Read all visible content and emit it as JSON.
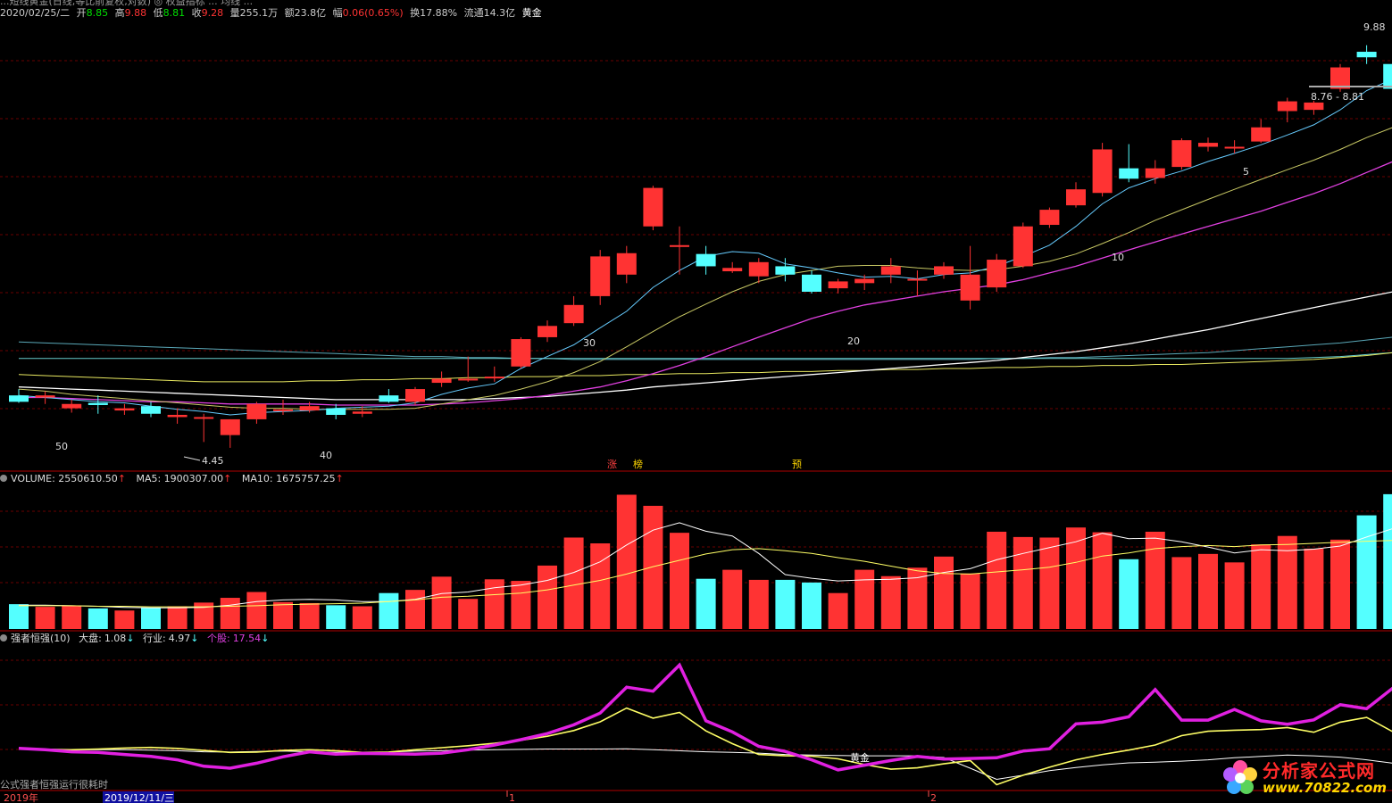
{
  "header": {
    "line1": "...短线黄金(日线,等比前复权,对数)  ◎ 权益指标 ...  均线 ...",
    "date": "2020/02/25/二",
    "open_label": "开",
    "open": "8.85",
    "high_label": "高",
    "high": "9.88",
    "low_label": "低",
    "low": "8.81",
    "close_label": "收",
    "close": "9.28",
    "vol_label": "量",
    "vol": "255.1万",
    "amt_label": "额",
    "amt": "23.8亿",
    "chg_label": "幅",
    "chg": "0.06(0.65%)",
    "turn_label": "换",
    "turn": "17.88%",
    "float_label": "流通",
    "float": "14.3亿",
    "tag": "黄金"
  },
  "price_panel": {
    "high_label": "9.88",
    "range_label": "8.76 - 8.81",
    "low_label": "4.45",
    "count_labels": [
      "50",
      "40",
      "30",
      "20",
      "10",
      "5"
    ],
    "event_labels": [
      "涨",
      "榜",
      "预"
    ]
  },
  "volume_panel": {
    "title": "VOLUME: 2550610.50",
    "ma5": "MA5: 1900307.00",
    "ma10": "MA10: 1675757.25"
  },
  "indicator_panel": {
    "name": "强者恒强(10)",
    "market_label": "大盘:",
    "market": "1.08",
    "industry_label": "行业:",
    "industry": "4.97",
    "stock_label": "个股:",
    "stock": "17.54",
    "cross_label": "黄金",
    "footer_note": "公式强者恒强运行很耗时"
  },
  "time_axis": {
    "year": "2019年",
    "cursor_date": "2019/12/11/三",
    "month_1": "1",
    "month_2": "2"
  },
  "logo": {
    "name": "分析家公式网",
    "url": "www.70822.com"
  },
  "colors": {
    "up": "#ff3333",
    "down": "#54ffff",
    "ma5": "#66ccff",
    "ma10": "#c8c864",
    "ma20": "#e040e0",
    "ma60": "#ffffff",
    "grid": "#6a0000"
  },
  "chart_data": [
    {
      "type": "candlestick",
      "title": "",
      "ylim": [
        4.3,
        10.0
      ],
      "y_scale": "log",
      "candles": [
        {
          "o": 4.92,
          "h": 4.98,
          "l": 4.85,
          "c": 4.86
        },
        {
          "o": 4.9,
          "h": 4.96,
          "l": 4.84,
          "c": 4.92
        },
        {
          "o": 4.8,
          "h": 4.88,
          "l": 4.76,
          "c": 4.84
        },
        {
          "o": 4.85,
          "h": 4.92,
          "l": 4.75,
          "c": 4.83
        },
        {
          "o": 4.78,
          "h": 4.84,
          "l": 4.74,
          "c": 4.8
        },
        {
          "o": 4.82,
          "h": 4.86,
          "l": 4.72,
          "c": 4.75
        },
        {
          "o": 4.72,
          "h": 4.8,
          "l": 4.66,
          "c": 4.74
        },
        {
          "o": 4.72,
          "h": 4.75,
          "l": 4.5,
          "c": 4.72
        },
        {
          "o": 4.56,
          "h": 4.7,
          "l": 4.45,
          "c": 4.7
        },
        {
          "o": 4.7,
          "h": 4.86,
          "l": 4.66,
          "c": 4.84
        },
        {
          "o": 4.78,
          "h": 4.88,
          "l": 4.74,
          "c": 4.79
        },
        {
          "o": 4.78,
          "h": 4.86,
          "l": 4.76,
          "c": 4.82
        },
        {
          "o": 4.8,
          "h": 4.84,
          "l": 4.7,
          "c": 4.74
        },
        {
          "o": 4.75,
          "h": 4.82,
          "l": 4.72,
          "c": 4.77
        },
        {
          "o": 4.92,
          "h": 4.98,
          "l": 4.85,
          "c": 4.86
        },
        {
          "o": 4.86,
          "h": 5.0,
          "l": 4.83,
          "c": 4.98
        },
        {
          "o": 5.04,
          "h": 5.15,
          "l": 5.0,
          "c": 5.08
        },
        {
          "o": 5.07,
          "h": 5.3,
          "l": 5.05,
          "c": 5.08
        },
        {
          "o": 5.1,
          "h": 5.2,
          "l": 5.05,
          "c": 5.1
        },
        {
          "o": 5.2,
          "h": 5.5,
          "l": 5.18,
          "c": 5.48
        },
        {
          "o": 5.5,
          "h": 5.68,
          "l": 5.45,
          "c": 5.62
        },
        {
          "o": 5.65,
          "h": 5.95,
          "l": 5.62,
          "c": 5.85
        },
        {
          "o": 5.95,
          "h": 6.5,
          "l": 5.85,
          "c": 6.42
        },
        {
          "o": 6.2,
          "h": 6.55,
          "l": 6.1,
          "c": 6.46
        },
        {
          "o": 6.8,
          "h": 7.35,
          "l": 6.75,
          "c": 7.32
        },
        {
          "o": 6.55,
          "h": 6.8,
          "l": 6.2,
          "c": 6.56
        },
        {
          "o": 6.45,
          "h": 6.55,
          "l": 6.2,
          "c": 6.3
        },
        {
          "o": 6.24,
          "h": 6.35,
          "l": 6.22,
          "c": 6.28
        },
        {
          "o": 6.18,
          "h": 6.4,
          "l": 6.1,
          "c": 6.35
        },
        {
          "o": 6.3,
          "h": 6.4,
          "l": 6.12,
          "c": 6.2
        },
        {
          "o": 6.2,
          "h": 6.25,
          "l": 5.98,
          "c": 6.0
        },
        {
          "o": 6.04,
          "h": 6.15,
          "l": 5.98,
          "c": 6.12
        },
        {
          "o": 6.1,
          "h": 6.2,
          "l": 6.02,
          "c": 6.15
        },
        {
          "o": 6.2,
          "h": 6.4,
          "l": 6.1,
          "c": 6.3
        },
        {
          "o": 6.14,
          "h": 6.25,
          "l": 5.95,
          "c": 6.15
        },
        {
          "o": 6.2,
          "h": 6.35,
          "l": 6.15,
          "c": 6.3
        },
        {
          "o": 5.9,
          "h": 6.55,
          "l": 5.8,
          "c": 6.2
        },
        {
          "o": 6.05,
          "h": 6.45,
          "l": 6.0,
          "c": 6.38
        },
        {
          "o": 6.3,
          "h": 6.85,
          "l": 6.28,
          "c": 6.8
        },
        {
          "o": 6.82,
          "h": 7.05,
          "l": 6.78,
          "c": 7.02
        },
        {
          "o": 7.08,
          "h": 7.4,
          "l": 7.05,
          "c": 7.3
        },
        {
          "o": 7.25,
          "h": 7.98,
          "l": 7.2,
          "c": 7.88
        },
        {
          "o": 7.6,
          "h": 7.96,
          "l": 7.4,
          "c": 7.45
        },
        {
          "o": 7.46,
          "h": 7.72,
          "l": 7.38,
          "c": 7.6
        },
        {
          "o": 7.62,
          "h": 8.05,
          "l": 7.58,
          "c": 8.02
        },
        {
          "o": 7.92,
          "h": 8.06,
          "l": 7.85,
          "c": 7.98
        },
        {
          "o": 7.92,
          "h": 8.02,
          "l": 7.82,
          "c": 7.92
        },
        {
          "o": 8.0,
          "h": 8.35,
          "l": 7.98,
          "c": 8.22
        },
        {
          "o": 8.48,
          "h": 8.7,
          "l": 8.3,
          "c": 8.64
        },
        {
          "o": 8.5,
          "h": 8.65,
          "l": 8.42,
          "c": 8.62
        },
        {
          "o": 8.85,
          "h": 9.28,
          "l": 8.8,
          "c": 9.22
        },
        {
          "o": 9.5,
          "h": 9.62,
          "l": 9.28,
          "c": 9.4
        },
        {
          "o": 9.28,
          "h": 9.88,
          "l": 8.81,
          "c": 8.85
        }
      ],
      "ma5": [
        4.92,
        4.9,
        4.88,
        4.86,
        4.85,
        4.82,
        4.79,
        4.77,
        4.74,
        4.76,
        4.77,
        4.78,
        4.8,
        4.81,
        4.82,
        4.85,
        4.93,
        4.99,
        5.03,
        5.18,
        5.3,
        5.42,
        5.6,
        5.78,
        6.05,
        6.25,
        6.42,
        6.48,
        6.46,
        6.33,
        6.28,
        6.22,
        6.17,
        6.18,
        6.15,
        6.2,
        6.22,
        6.3,
        6.42,
        6.56,
        6.8,
        7.1,
        7.32,
        7.45,
        7.56,
        7.7,
        7.82,
        7.95,
        8.1,
        8.26,
        8.5,
        8.82,
        9.02
      ],
      "ma10": [
        4.98,
        4.96,
        4.93,
        4.91,
        4.89,
        4.87,
        4.85,
        4.83,
        4.81,
        4.8,
        4.8,
        4.79,
        4.79,
        4.79,
        4.79,
        4.8,
        4.84,
        4.88,
        4.92,
        4.98,
        5.05,
        5.14,
        5.25,
        5.4,
        5.56,
        5.72,
        5.86,
        6.0,
        6.12,
        6.2,
        6.25,
        6.3,
        6.31,
        6.31,
        6.28,
        6.26,
        6.25,
        6.26,
        6.3,
        6.36,
        6.45,
        6.58,
        6.72,
        6.88,
        7.02,
        7.16,
        7.3,
        7.44,
        7.58,
        7.72,
        7.88,
        8.06,
        8.22
      ],
      "ma20": [
        4.9,
        4.9,
        4.89,
        4.88,
        4.87,
        4.86,
        4.86,
        4.85,
        4.84,
        4.84,
        4.84,
        4.84,
        4.83,
        4.83,
        4.83,
        4.83,
        4.84,
        4.85,
        4.87,
        4.89,
        4.92,
        4.96,
        5.0,
        5.06,
        5.13,
        5.21,
        5.3,
        5.4,
        5.5,
        5.6,
        5.7,
        5.78,
        5.85,
        5.9,
        5.95,
        6.0,
        6.04,
        6.08,
        6.14,
        6.22,
        6.3,
        6.4,
        6.5,
        6.6,
        6.7,
        6.8,
        6.9,
        7.0,
        7.12,
        7.24,
        7.38,
        7.54,
        7.7
      ],
      "ma60": [
        5.0,
        4.99,
        4.98,
        4.97,
        4.96,
        4.95,
        4.94,
        4.93,
        4.92,
        4.91,
        4.9,
        4.89,
        4.88,
        4.88,
        4.88,
        4.88,
        4.88,
        4.88,
        4.89,
        4.9,
        4.91,
        4.93,
        4.95,
        4.97,
        5.0,
        5.02,
        5.04,
        5.06,
        5.08,
        5.1,
        5.12,
        5.14,
        5.16,
        5.18,
        5.2,
        5.22,
        5.24,
        5.26,
        5.29,
        5.32,
        5.35,
        5.39,
        5.43,
        5.48,
        5.53,
        5.58,
        5.64,
        5.7,
        5.76,
        5.82,
        5.88,
        5.94,
        6.0
      ],
      "long_ma_a": [
        5.45,
        5.44,
        5.43,
        5.42,
        5.41,
        5.4,
        5.39,
        5.38,
        5.37,
        5.36,
        5.35,
        5.34,
        5.33,
        5.32,
        5.31,
        5.3,
        5.3,
        5.29,
        5.29,
        5.28,
        5.28,
        5.27,
        5.27,
        5.27,
        5.27,
        5.27,
        5.27,
        5.27,
        5.27,
        5.27,
        5.27,
        5.27,
        5.27,
        5.27,
        5.27,
        5.27,
        5.27,
        5.28,
        5.28,
        5.29,
        5.29,
        5.3,
        5.31,
        5.32,
        5.33,
        5.34,
        5.36,
        5.38,
        5.4,
        5.42,
        5.44,
        5.47,
        5.5
      ],
      "long_ma_b": [
        5.28,
        5.28,
        5.28,
        5.28,
        5.28,
        5.28,
        5.28,
        5.28,
        5.28,
        5.28,
        5.28,
        5.28,
        5.28,
        5.28,
        5.28,
        5.28,
        5.28,
        5.28,
        5.28,
        5.28,
        5.28,
        5.28,
        5.28,
        5.28,
        5.28,
        5.28,
        5.28,
        5.28,
        5.28,
        5.28,
        5.28,
        5.28,
        5.28,
        5.28,
        5.28,
        5.28,
        5.28,
        5.28,
        5.28,
        5.28,
        5.28,
        5.28,
        5.28,
        5.28,
        5.28,
        5.28,
        5.28,
        5.28,
        5.28,
        5.29,
        5.3,
        5.32,
        5.34
      ],
      "long_ma_c": [
        5.12,
        5.11,
        5.1,
        5.09,
        5.08,
        5.07,
        5.06,
        5.05,
        5.05,
        5.05,
        5.05,
        5.06,
        5.06,
        5.07,
        5.07,
        5.08,
        5.08,
        5.09,
        5.09,
        5.1,
        5.1,
        5.11,
        5.11,
        5.12,
        5.12,
        5.13,
        5.13,
        5.14,
        5.14,
        5.15,
        5.15,
        5.16,
        5.16,
        5.17,
        5.17,
        5.18,
        5.18,
        5.19,
        5.19,
        5.2,
        5.2,
        5.21,
        5.21,
        5.22,
        5.22,
        5.23,
        5.24,
        5.25,
        5.26,
        5.27,
        5.29,
        5.31,
        5.34
      ]
    },
    {
      "type": "bar",
      "title": "VOLUME",
      "ylim": [
        0,
        2700000
      ],
      "values": [
        470000,
        420000,
        440000,
        390000,
        350000,
        400000,
        430000,
        500000,
        590000,
        700000,
        510000,
        490000,
        450000,
        430000,
        680000,
        740000,
        990000,
        570000,
        940000,
        910000,
        1200000,
        1730000,
        1620000,
        2540000,
        2330000,
        1820000,
        950000,
        1120000,
        930000,
        930000,
        880000,
        680000,
        1120000,
        1000000,
        1160000,
        1370000,
        1050000,
        1840000,
        1740000,
        1730000,
        1920000,
        1830000,
        1320000,
        1840000,
        1360000,
        1420000,
        1260000,
        1600000,
        1760000,
        1520000,
        1690000,
        2150000,
        2550000
      ],
      "ma5": [
        450000,
        450000,
        440000,
        430000,
        410000,
        400000,
        400000,
        410000,
        450000,
        520000,
        550000,
        560000,
        550000,
        520000,
        520000,
        560000,
        670000,
        700000,
        780000,
        830000,
        920000,
        1070000,
        1270000,
        1590000,
        1870000,
        2010000,
        1850000,
        1760000,
        1430000,
        1030000,
        960000,
        910000,
        930000,
        940000,
        970000,
        1070000,
        1140000,
        1310000,
        1430000,
        1540000,
        1650000,
        1810000,
        1710000,
        1720000,
        1650000,
        1550000,
        1440000,
        1500000,
        1480000,
        1510000,
        1570000,
        1740000,
        1900307
      ],
      "ma10": [
        440000,
        440000,
        440000,
        430000,
        430000,
        420000,
        420000,
        420000,
        430000,
        440000,
        460000,
        470000,
        480000,
        490000,
        520000,
        550000,
        600000,
        620000,
        650000,
        680000,
        740000,
        830000,
        920000,
        1040000,
        1180000,
        1300000,
        1420000,
        1500000,
        1520000,
        1480000,
        1430000,
        1350000,
        1280000,
        1190000,
        1100000,
        1050000,
        1040000,
        1080000,
        1120000,
        1170000,
        1260000,
        1380000,
        1440000,
        1520000,
        1560000,
        1580000,
        1560000,
        1590000,
        1600000,
        1620000,
        1640000,
        1660000,
        1675757
      ]
    },
    {
      "type": "line",
      "title": "强者恒强(10)",
      "ylim": [
        -5,
        38
      ],
      "series": [
        {
          "name": "大盘",
          "values": [
            7.0,
            6.8,
            6.6,
            6.6,
            6.6,
            6.5,
            6.3,
            6.0,
            5.9,
            6.1,
            6.2,
            6.0,
            5.8,
            5.8,
            5.9,
            6.2,
            6.3,
            6.5,
            6.6,
            6.7,
            6.8,
            6.8,
            6.8,
            6.9,
            6.6,
            6.3,
            6.0,
            5.8,
            5.6,
            5.2,
            5.0,
            4.9,
            4.8,
            4.8,
            4.8,
            4.3,
            1.1,
            -2.2,
            -1.0,
            0.4,
            1.3,
            2.1,
            2.7,
            2.9,
            3.2,
            3.6,
            4.2,
            4.6,
            5.0,
            4.8,
            4.4,
            3.6,
            2.6
          ]
        },
        {
          "name": "行业",
          "values": [
            6.9,
            6.7,
            6.6,
            6.8,
            7.1,
            7.3,
            7.0,
            6.4,
            5.8,
            5.9,
            6.4,
            6.6,
            6.3,
            5.8,
            5.9,
            6.6,
            7.2,
            7.8,
            8.5,
            9.4,
            10.6,
            12.3,
            14.9,
            19.0,
            16.0,
            17.7,
            12.2,
            8.4,
            5.2,
            4.8,
            4.7,
            3.9,
            2.2,
            0.8,
            1.2,
            2.4,
            3.4,
            -3.8,
            -1.0,
            1.4,
            3.6,
            5.2,
            6.5,
            8.0,
            10.8,
            12.1,
            12.4,
            12.6,
            13.2,
            11.8,
            14.8,
            16.2,
            11.9
          ]
        },
        {
          "name": "个股",
          "values": [
            7.0,
            6.6,
            6.0,
            5.8,
            5.2,
            4.6,
            3.6,
            1.7,
            1.1,
            2.6,
            4.5,
            6.0,
            5.3,
            5.5,
            5.4,
            5.3,
            5.6,
            6.6,
            8.0,
            9.6,
            11.4,
            14.0,
            17.5,
            25.2,
            24.0,
            31.8,
            15.2,
            11.9,
            7.6,
            6.1,
            3.6,
            0.6,
            2.0,
            3.4,
            4.6,
            3.8,
            4.0,
            4.2,
            6.2,
            6.9,
            14.3,
            14.8,
            16.4,
            24.5,
            15.4,
            15.4,
            18.6,
            15.2,
            14.2,
            15.5,
            20.0,
            18.8,
            25.0
          ]
        }
      ]
    }
  ]
}
